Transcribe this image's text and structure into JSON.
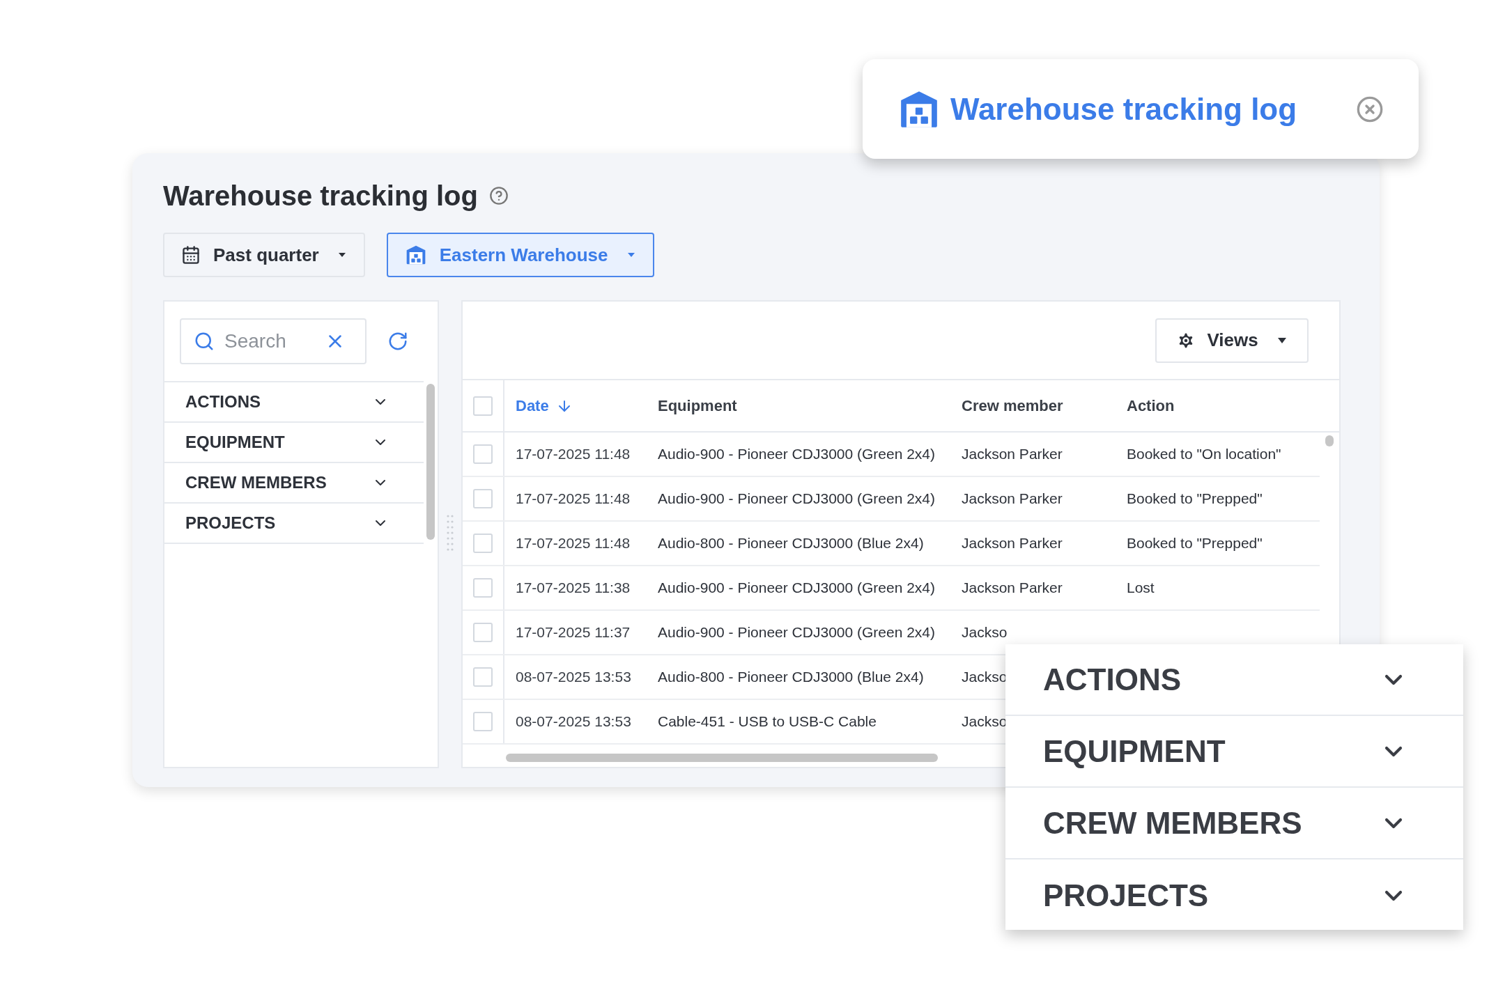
{
  "callout": {
    "title": "Warehouse tracking log"
  },
  "page": {
    "title": "Warehouse tracking log"
  },
  "filters_bar": [
    {
      "kind": "date",
      "label": "Past quarter",
      "selected": false
    },
    {
      "kind": "warehouse",
      "label": "Eastern Warehouse",
      "selected": true
    }
  ],
  "sidebar": {
    "search": {
      "placeholder": "Search"
    },
    "groups": [
      {
        "label": "ACTIONS"
      },
      {
        "label": "EQUIPMENT"
      },
      {
        "label": "CREW MEMBERS"
      },
      {
        "label": "PROJECTS"
      }
    ]
  },
  "table": {
    "views_button": "Views",
    "select_all": {
      "checked": false
    },
    "columns": [
      {
        "label": "Date",
        "sorted": true
      },
      {
        "label": "Equipment",
        "sorted": false
      },
      {
        "label": "Crew member",
        "sorted": false
      },
      {
        "label": "Action",
        "sorted": false
      }
    ],
    "rows": [
      {
        "date": "17-07-2025 11:48",
        "equipment": "Audio-900 - Pioneer CDJ3000 (Green 2x4)",
        "crew": "Jackson Parker",
        "action": "Booked to \"On location\"",
        "checked": false
      },
      {
        "date": "17-07-2025 11:48",
        "equipment": "Audio-900 - Pioneer CDJ3000 (Green 2x4)",
        "crew": "Jackson Parker",
        "action": "Booked to \"Prepped\"",
        "checked": false
      },
      {
        "date": "17-07-2025 11:48",
        "equipment": "Audio-800 - Pioneer CDJ3000 (Blue 2x4)",
        "crew": "Jackson Parker",
        "action": "Booked to \"Prepped\"",
        "checked": false
      },
      {
        "date": "17-07-2025 11:38",
        "equipment": "Audio-900 - Pioneer CDJ3000 (Green 2x4)",
        "crew": "Jackson Parker",
        "action": "Lost",
        "checked": false
      },
      {
        "date": "17-07-2025 11:37",
        "equipment": "Audio-900 - Pioneer CDJ3000 (Green 2x4)",
        "crew": "Jackso",
        "checked": false
      },
      {
        "date": "08-07-2025 13:53",
        "equipment": "Audio-800 - Pioneer CDJ3000 (Blue 2x4)",
        "crew": "Jackso",
        "checked": false
      },
      {
        "date": "08-07-2025 13:53",
        "equipment": "Cable-451 - USB to USB-C Cable",
        "crew": "Jackso",
        "checked": false
      }
    ]
  },
  "zoomed_filters": [
    {
      "label": "ACTIONS"
    },
    {
      "label": "EQUIPMENT"
    },
    {
      "label": "CREW MEMBERS"
    },
    {
      "label": "PROJECTS"
    }
  ]
}
